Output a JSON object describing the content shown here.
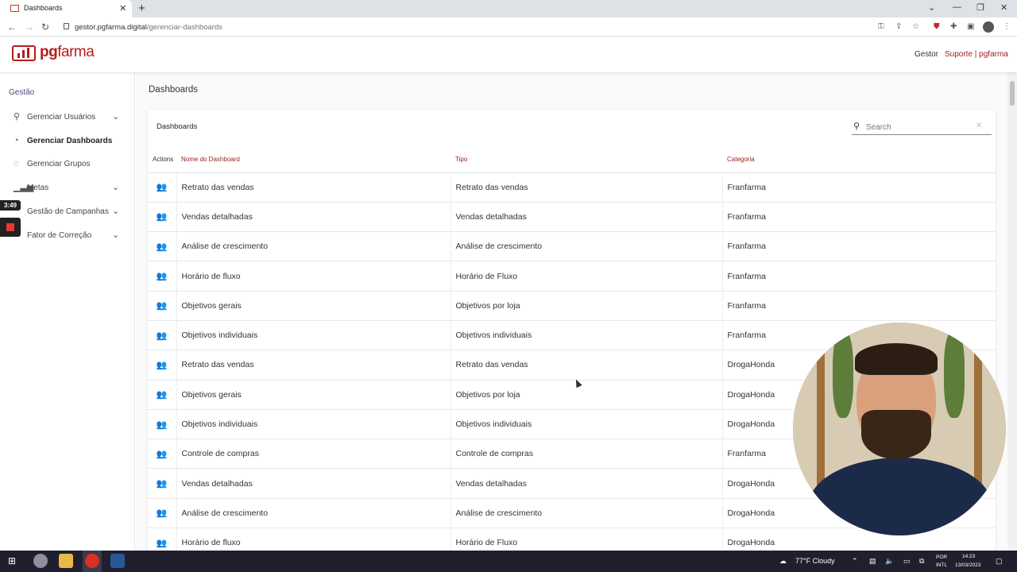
{
  "browser": {
    "tab_title": "Dashboards",
    "url_domain": "gestor.pgfarma.digital",
    "url_path": "/gerenciar-dashboards"
  },
  "header": {
    "logo_pg": "pg",
    "logo_farma": "farma",
    "user": "Gestor",
    "support": "Suporte | pgfarma"
  },
  "sidebar": {
    "section": "Gestão",
    "items": [
      {
        "label": "Gerenciar Usuários",
        "icon": "add-user-icon",
        "has_chevron": true,
        "active": false
      },
      {
        "label": "Gerenciar Dashboards",
        "icon": "clock-pie-icon",
        "has_chevron": false,
        "active": true
      },
      {
        "label": "Gerenciar Grupos",
        "icon": "check-circle-icon",
        "has_chevron": false,
        "active": false
      },
      {
        "label": "Metas",
        "icon": "bar-chart-icon",
        "has_chevron": true,
        "active": false
      },
      {
        "label": "Gestão de Campanhas",
        "icon": "campaign-icon",
        "has_chevron": true,
        "active": false
      },
      {
        "label": "Fator de Correção",
        "icon": "adjust-icon",
        "has_chevron": true,
        "active": false
      }
    ]
  },
  "recorder": {
    "time": "3:49"
  },
  "main": {
    "page_title": "Dashboards",
    "card_title": "Dashboards",
    "search_placeholder": "Search",
    "columns": [
      "Actions",
      "Nome do Dashboard",
      "Tipo",
      "Categoria"
    ],
    "rows": [
      [
        "Retrato das vendas",
        "Retrato das vendas",
        "Franfarma"
      ],
      [
        "Vendas detalhadas",
        "Vendas detalhadas",
        "Franfarma"
      ],
      [
        "Análise de crescimento",
        "Análise de crescimento",
        "Franfarma"
      ],
      [
        "Horário de fluxo",
        "Horário de Fluxo",
        "Franfarma"
      ],
      [
        "Objetivos gerais",
        "Objetivos por loja",
        "Franfarma"
      ],
      [
        "Objetivos individuais",
        "Objetivos individuais",
        "Franfarma"
      ],
      [
        "Retrato das vendas",
        "Retrato das vendas",
        "DrogaHonda"
      ],
      [
        "Objetivos gerais",
        "Objetivos por loja",
        "DrogaHonda"
      ],
      [
        "Objetivos individuais",
        "Objetivos individuais",
        "DrogaHonda"
      ],
      [
        "Controle de compras",
        "Controle de compras",
        "Franfarma"
      ],
      [
        "Vendas detalhadas",
        "Vendas detalhadas",
        "DrogaHonda"
      ],
      [
        "Análise de crescimento",
        "Análise de crescimento",
        "DrogaHonda"
      ],
      [
        "Horário de fluxo",
        "Horário de Fluxo",
        "DrogaHonda"
      ]
    ]
  },
  "taskbar": {
    "weather": "77°F  Cloudy",
    "lang_top": "POR",
    "lang_bottom": "INTL",
    "time": "14:23",
    "date": "13/03/2023"
  },
  "colors": {
    "brand": "#b71c1c",
    "accent_text": "#9b1b1b"
  }
}
